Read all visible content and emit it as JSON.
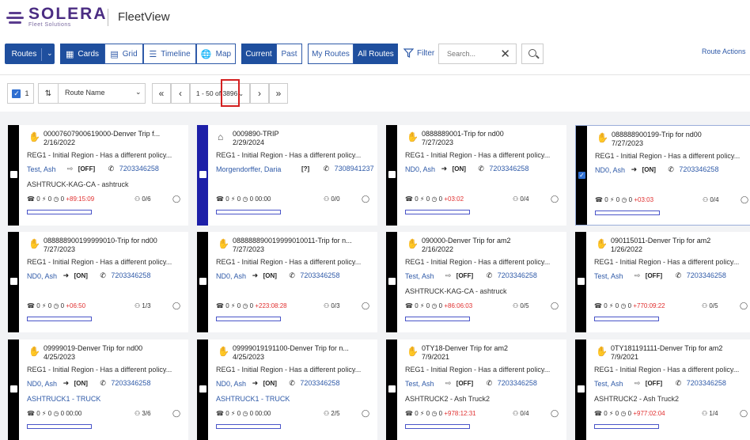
{
  "app": {
    "logo_name": "SOLERA",
    "logo_sub": "Fleet Solutions",
    "title": "FleetView"
  },
  "toolbar": {
    "routes": "Routes",
    "views": [
      "Cards",
      "Grid",
      "Timeline",
      "Map"
    ],
    "active_view": "Cards",
    "time_filters": [
      "Current",
      "Past"
    ],
    "active_time": "Current",
    "scope_filters": [
      "My Routes",
      "All Routes"
    ],
    "active_scope": "All Routes",
    "filter": "Filter",
    "search_placeholder": "Search...",
    "route_actions": "Route Actions"
  },
  "pager": {
    "selected_count": "1",
    "sort_field": "Route Name",
    "range": "1 - 50 of 3896"
  },
  "cards": [
    {
      "title": "00007607900619000-Denver Trip f...",
      "date": "2/16/2022",
      "region": "REG1 - Initial Region - Has a different policy...",
      "driver": "Test, Ash",
      "login": "arrow",
      "status": "[OFF]",
      "phone": "7203346258",
      "truck": "ASHTRUCK-KAG-CA - ashtruck",
      "truck_link": false,
      "alerts": "0",
      "events": "0",
      "time": "0",
      "late": "+89:15:09",
      "stops": "0/6",
      "icon": "hand",
      "bar": "black",
      "selected": false
    },
    {
      "title": "0009890-TRIP",
      "date": "2/29/2024",
      "region": "REG1 - Initial Region - Has a different policy...",
      "driver": "Morgendorffer, Daria",
      "login": "",
      "status": "[?]",
      "phone": "7308941237",
      "truck": "",
      "truck_link": false,
      "alerts": "0",
      "events": "0",
      "time": "0 00:00",
      "late": "",
      "stops": "0/0",
      "icon": "home",
      "bar": "blue",
      "selected": false
    },
    {
      "title": "0888889001-Trip for nd00",
      "date": "7/27/2023",
      "region": "REG1 - Initial Region - Has a different policy...",
      "driver": "ND0, Ash",
      "login": "in",
      "status": "[ON]",
      "phone": "7203346258",
      "truck": "",
      "truck_link": false,
      "alerts": "0",
      "events": "0",
      "time": "0",
      "late": "+03:02",
      "stops": "0/4",
      "icon": "hand",
      "bar": "black",
      "selected": false
    },
    {
      "title": "088888900199-Trip for nd00",
      "date": "7/27/2023",
      "region": "REG1 - Initial Region - Has a different policy...",
      "driver": "ND0, Ash",
      "login": "in",
      "status": "[ON]",
      "phone": "7203346258",
      "truck": "",
      "truck_link": false,
      "alerts": "0",
      "events": "0",
      "time": "0",
      "late": "+03:03",
      "stops": "0/4",
      "icon": "hand",
      "bar": "black",
      "selected": true
    },
    {
      "title": "088888900199999010-Trip for nd00",
      "date": "7/27/2023",
      "region": "REG1 - Initial Region - Has a different policy...",
      "driver": "ND0, Ash",
      "login": "in",
      "status": "[ON]",
      "phone": "7203346258",
      "truck": "",
      "truck_link": false,
      "alerts": "0",
      "events": "0",
      "time": "0",
      "late": "+06:50",
      "stops": "1/3",
      "icon": "hand",
      "bar": "black",
      "selected": false
    },
    {
      "title": "088888890019999010011-Trip for n...",
      "date": "7/27/2023",
      "region": "REG1 - Initial Region - Has a different policy...",
      "driver": "ND0, Ash",
      "login": "in",
      "status": "[ON]",
      "phone": "7203346258",
      "truck": "",
      "truck_link": false,
      "alerts": "0",
      "events": "0",
      "time": "0",
      "late": "+223:08:28",
      "stops": "0/3",
      "icon": "hand",
      "bar": "black",
      "selected": false
    },
    {
      "title": "090000-Denver Trip for am2",
      "date": "2/16/2022",
      "region": "REG1 - Initial Region - Has a different policy...",
      "driver": "Test, Ash",
      "login": "arrow",
      "status": "[OFF]",
      "phone": "7203346258",
      "truck": "ASHTRUCK-KAG-CA - ashtruck",
      "truck_link": false,
      "alerts": "0",
      "events": "0",
      "time": "0",
      "late": "+86:06:03",
      "stops": "0/5",
      "icon": "hand",
      "bar": "black",
      "selected": false
    },
    {
      "title": "090115011-Denver Trip for am2",
      "date": "1/26/2022",
      "region": "REG1 - Initial Region - Has a different policy...",
      "driver": "Test, Ash",
      "login": "arrow",
      "status": "[OFF]",
      "phone": "7203346258",
      "truck": "",
      "truck_link": false,
      "alerts": "0",
      "events": "0",
      "time": "0",
      "late": "+770:09:22",
      "stops": "0/5",
      "icon": "hand",
      "bar": "black",
      "selected": false
    },
    {
      "title": "09999019-Denver Trip for nd00",
      "date": "4/25/2023",
      "region": "REG1 - Initial Region - Has a different policy...",
      "driver": "ND0, Ash",
      "login": "in",
      "status": "[ON]",
      "phone": "7203346258",
      "truck": "ASHTRUCK1 - TRUCK",
      "truck_link": true,
      "alerts": "0",
      "events": "0",
      "time": "0 00:00",
      "late": "",
      "stops": "3/6",
      "icon": "hand",
      "bar": "black",
      "selected": false
    },
    {
      "title": "09999019191100-Denver Trip for n...",
      "date": "4/25/2023",
      "region": "REG1 - Initial Region - Has a different policy...",
      "driver": "ND0, Ash",
      "login": "in",
      "status": "[ON]",
      "phone": "7203346258",
      "truck": "ASHTRUCK1 - TRUCK",
      "truck_link": true,
      "alerts": "0",
      "events": "0",
      "time": "0 00:00",
      "late": "",
      "stops": "2/5",
      "icon": "hand",
      "bar": "black",
      "selected": false
    },
    {
      "title": "0TY18-Denver Trip for am2",
      "date": "7/9/2021",
      "region": "REG1 - Initial Region - Has a different policy...",
      "driver": "Test, Ash",
      "login": "arrow",
      "status": "[OFF]",
      "phone": "7203346258",
      "truck": "ASHTRUCK2 - Ash Truck2",
      "truck_link": false,
      "alerts": "0",
      "events": "0",
      "time": "0",
      "late": "+978:12:31",
      "stops": "0/4",
      "icon": "hand",
      "bar": "black",
      "selected": false
    },
    {
      "title": "0TY181191111-Denver Trip for am2",
      "date": "7/9/2021",
      "region": "REG1 - Initial Region - Has a different policy...",
      "driver": "Test, Ash",
      "login": "arrow",
      "status": "[OFF]",
      "phone": "7203346258",
      "truck": "ASHTRUCK2 - Ash Truck2",
      "truck_link": false,
      "alerts": "0",
      "events": "0",
      "time": "0",
      "late": "+977:02:04",
      "stops": "1/4",
      "icon": "hand",
      "bar": "black",
      "selected": false
    }
  ]
}
